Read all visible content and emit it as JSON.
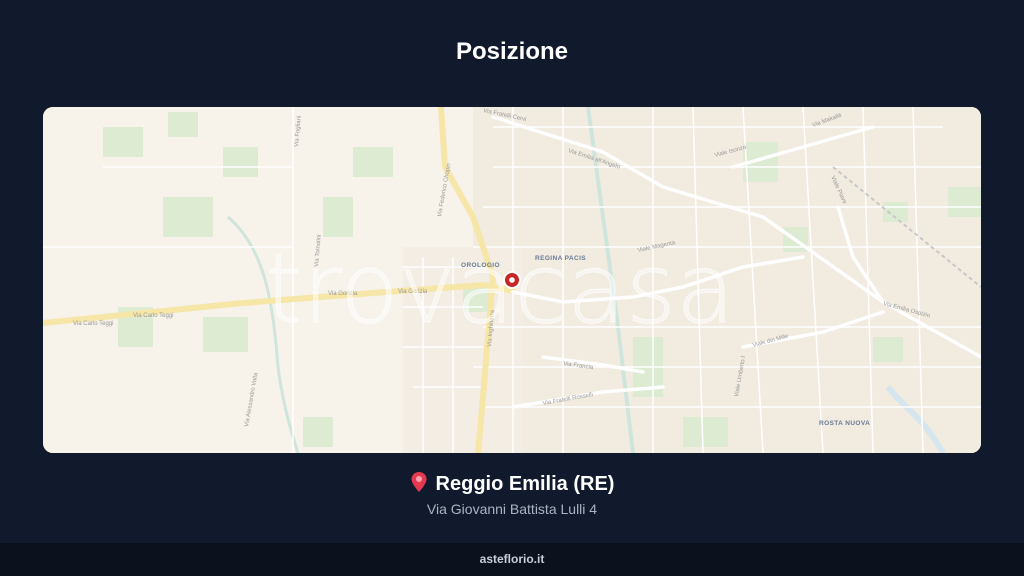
{
  "header": {
    "title": "Posizione"
  },
  "map": {
    "watermark": "trovacasa",
    "districts": {
      "orologio": "OROLOGIO",
      "regina_pacis": "REGINA PACIS",
      "rosta_nuova": "ROSTA NUOVA"
    },
    "roads": {
      "via_carlo_teggi_1": "Via Carlo Teggi",
      "via_carlo_teggi_2": "Via Carlo Teggi",
      "via_gorizia_1": "Via Gorizia",
      "via_gorizia_2": "Via Gorizia",
      "via_emilia_angelo": "Via Emilia all'Angelo",
      "viale_magenta": "Viale Magenta",
      "viale_isonzo": "Viale Isonzo",
      "viale_dei_mille": "Viale dei Mille",
      "via_emilia_ospizio": "Via Emilia Ospizio",
      "via_inghilterra": "Via Inghilterra",
      "via_francia": "Via Francia",
      "via_fratelli_rosselli": "Via Fratelli Rosselli",
      "via_tornolini": "Via Tornolini",
      "via_fogliani": "Via Fogliani",
      "viale_piave": "Viale Piave",
      "via_makallè": "Via Makallè",
      "viale_umberto": "Viale Umberto I",
      "via_federico_chopin": "Via Federico Chopin",
      "via_fratelli_cervi": "Via Fratelli Cervi",
      "via_alessandro_volta": "Via Alessandro Volta"
    },
    "marker_icon": "location-marker-icon"
  },
  "location": {
    "icon": "map-pin-icon",
    "city": "Reggio Emilia (RE)",
    "address": "Via Giovanni Battista Lulli 4"
  },
  "footer": {
    "site": "asteflorio.it"
  }
}
